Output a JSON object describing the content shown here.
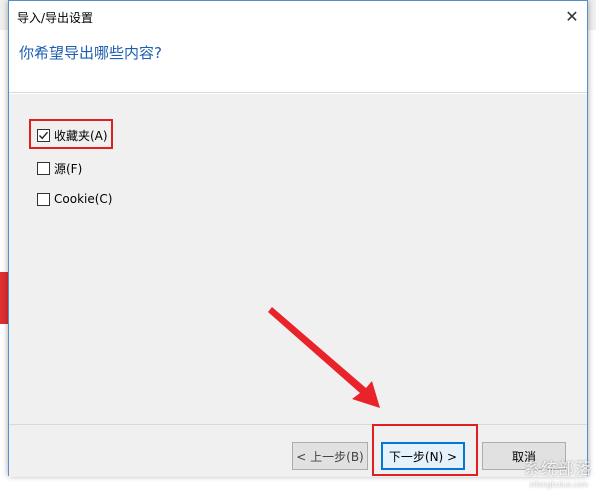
{
  "dialog": {
    "title": "导入/导出设置",
    "close_glyph": "✕",
    "question": "你希望导出哪些内容?",
    "options": [
      {
        "label": "收藏夹(A)",
        "checked": true
      },
      {
        "label": "源(F)",
        "checked": false
      },
      {
        "label": "Cookie(C)",
        "checked": false
      }
    ],
    "buttons": {
      "back": "< 上一步(B)",
      "next": "下一步(N) >",
      "cancel": "取消"
    }
  },
  "watermark": {
    "text": "系统部落",
    "sub": "xitongbuluo.com"
  },
  "colors": {
    "question_blue": "#1c5fb0",
    "highlight_red": "#e02020",
    "default_button_border": "#0078d7"
  }
}
